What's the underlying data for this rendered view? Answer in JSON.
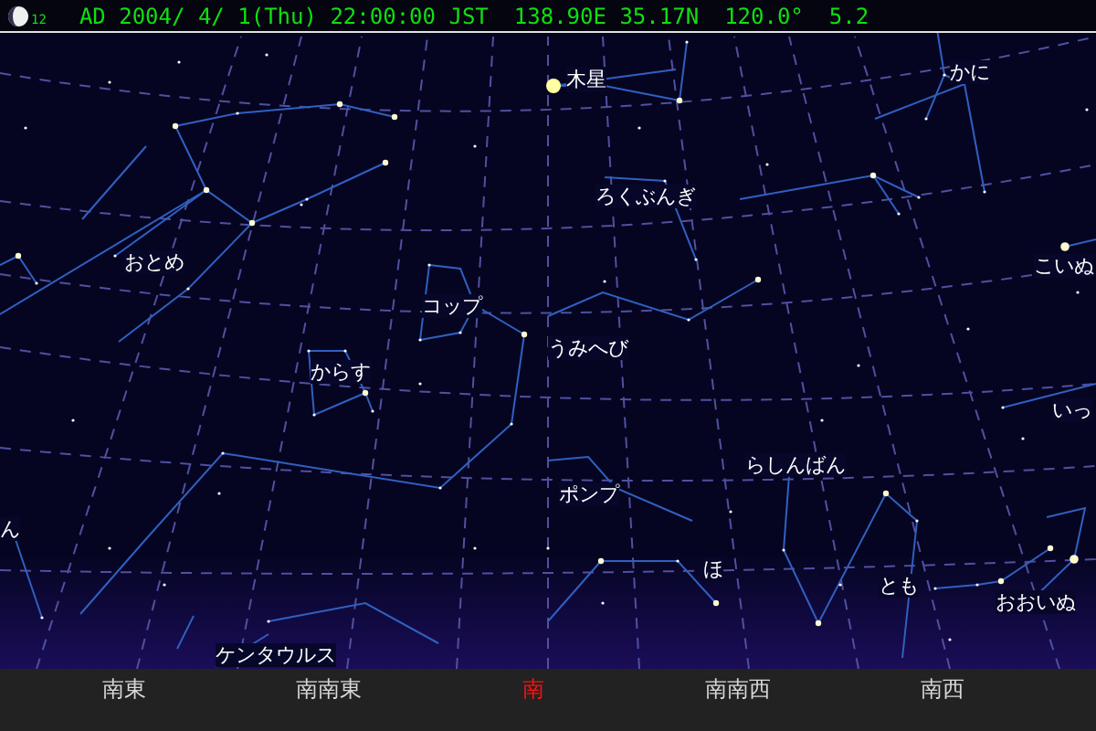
{
  "status_bar": {
    "moon_age": "12",
    "items": [
      "AD 2004/ 4/ 1(Thu) 22:00:00 JST",
      "138.90E 35.17N",
      "120.0°",
      "5.2"
    ]
  },
  "planets": [
    {
      "label": "木星"
    }
  ],
  "constellations": [
    {
      "label": "かに"
    },
    {
      "label": "ろくぶんぎ"
    },
    {
      "label": "こいぬ"
    },
    {
      "label": "おとめ"
    },
    {
      "label": "コップ"
    },
    {
      "label": "うみへび"
    },
    {
      "label": "からす"
    },
    {
      "label": "いっ"
    },
    {
      "label": "ん"
    },
    {
      "label": "らしんばん"
    },
    {
      "label": "ポンプ"
    },
    {
      "label": "ほ"
    },
    {
      "label": "とも"
    },
    {
      "label": "おおいぬ"
    },
    {
      "label": "ケンタウルス"
    }
  ],
  "directions": [
    {
      "label": "南東",
      "selected": false
    },
    {
      "label": "南南東",
      "selected": false
    },
    {
      "label": "南",
      "selected": true
    },
    {
      "label": "南南西",
      "selected": false
    },
    {
      "label": "南西",
      "selected": false
    }
  ]
}
